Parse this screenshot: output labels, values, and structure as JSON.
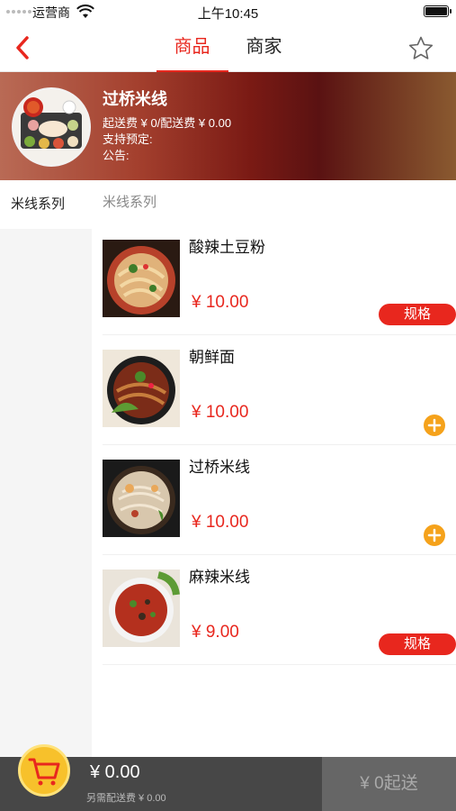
{
  "status_bar": {
    "carrier": "运营商",
    "time": "上午10:45"
  },
  "nav": {
    "tabs": [
      {
        "label": "商品",
        "active": true
      },
      {
        "label": "商家",
        "active": false
      }
    ],
    "accent_color": "#e8271e"
  },
  "shop": {
    "name": "过桥米线",
    "fee_text": "起送费 ¥ 0/配送费 ¥ 0.00",
    "reserve_text": "支持预定:",
    "notice_text": "公告:"
  },
  "categories": [
    {
      "label": "米线系列",
      "active": true
    }
  ],
  "section_title": "米线系列",
  "products": [
    {
      "name": "酸辣土豆粉",
      "price": "¥ 10.00",
      "action": "spec",
      "action_label": "规格"
    },
    {
      "name": "朝鲜面",
      "price": "¥ 10.00",
      "action": "add",
      "action_label": ""
    },
    {
      "name": "过桥米线",
      "price": "¥ 10.00",
      "action": "add",
      "action_label": ""
    },
    {
      "name": "麻辣米线",
      "price": "¥ 9.00",
      "action": "spec",
      "action_label": "规格"
    }
  ],
  "cart": {
    "total": "¥ 0.00",
    "delivery_note": "另需配送费 ¥ 0.00",
    "checkout_label": "¥ 0起送"
  }
}
